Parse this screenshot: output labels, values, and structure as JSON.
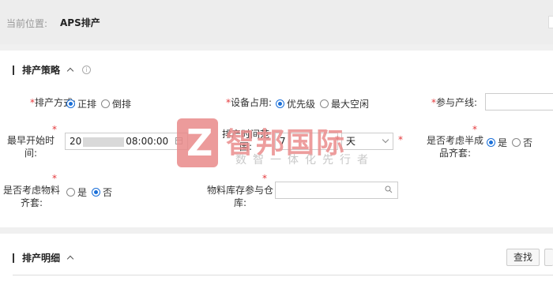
{
  "breadcrumb": {
    "label": "当前位置:",
    "current": "APS排产"
  },
  "strategy": {
    "title": "排产策略"
  },
  "fields": {
    "method": {
      "label": "排产方式:",
      "options": [
        "正排",
        "倒排"
      ],
      "selected": 0
    },
    "equipment": {
      "label": "设备占用:",
      "options": [
        "优先级",
        "最大空闲"
      ],
      "selected": 0
    },
    "line": {
      "label": "参与产线:"
    },
    "start_time": {
      "label": "最早开始时间:",
      "value_prefix": "20",
      "value_suffix": "08:00:00"
    },
    "range": {
      "label": "排产时间范围:",
      "value": "7",
      "unit": "天"
    },
    "semi": {
      "label": "是否考虑半成品齐套:",
      "options": [
        "是",
        "否"
      ],
      "selected": 0
    },
    "material": {
      "label": "是否考虑物料齐套:",
      "options": [
        "是",
        "否"
      ],
      "selected": 1
    },
    "warehouse": {
      "label": "物料库存参与仓库:"
    }
  },
  "watermark": {
    "logo": "Z",
    "title": "智邦国际",
    "subtitle": "数智一体化先行者"
  },
  "detail": {
    "title": "排产明细",
    "search_button": "查找"
  },
  "colors": {
    "accent": "#1a6fd8",
    "required": "#e4393c",
    "watermark": "#ea8d8d"
  }
}
